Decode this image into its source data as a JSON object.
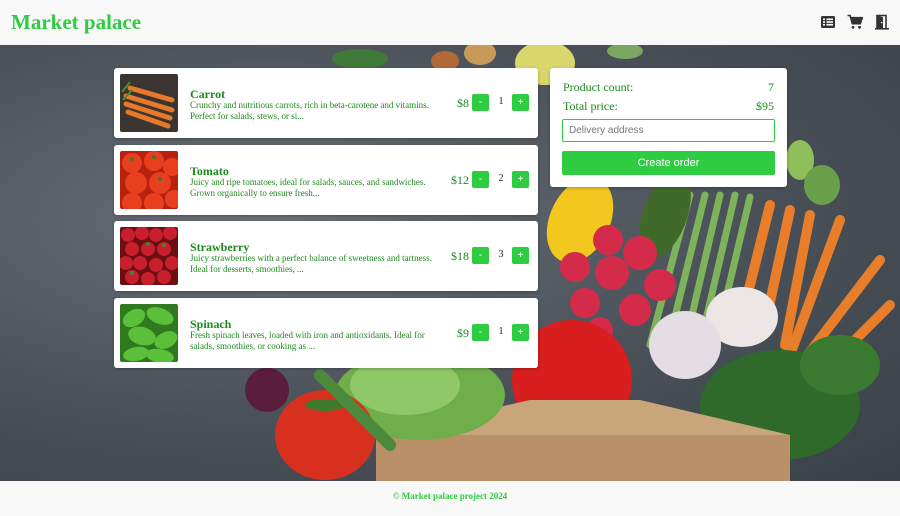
{
  "app": {
    "brand": "Market palace"
  },
  "header": {
    "icons": [
      "list-icon",
      "cart-icon",
      "logout-door-icon"
    ]
  },
  "products": [
    {
      "name": "Carrot",
      "description": "Crunchy and nutritious carrots, rich in beta-carotene and vitamins. Perfect for salads, stews, or si...",
      "price": "$8",
      "quantity": "1",
      "minus_label": "-",
      "plus_label": "+",
      "image": "carrot-image"
    },
    {
      "name": "Tomato",
      "description": "Juicy and ripe tomatoes, ideal for salads, sauces, and sandwiches. Grown organically to ensure fresh...",
      "price": "$12",
      "quantity": "2",
      "minus_label": "-",
      "plus_label": "+",
      "image": "tomato-image"
    },
    {
      "name": "Strawberry",
      "description": "Juicy strawberries with a perfect balance of sweetness and tartness. Ideal for desserts, smoothies, ...",
      "price": "$18",
      "quantity": "3",
      "minus_label": "-",
      "plus_label": "+",
      "image": "strawberry-image"
    },
    {
      "name": "Spinach",
      "description": "Fresh spinach leaves, loaded with iron and antioxidants. Ideal for salads, smoothies, or cooking as ...",
      "price": "$9",
      "quantity": "1",
      "minus_label": "-",
      "plus_label": "+",
      "image": "spinach-image"
    }
  ],
  "order": {
    "count_label": "Product count:",
    "count_value": "7",
    "total_label": "Total price:",
    "total_value": "$95",
    "address_placeholder": "Delivery address",
    "address_value": "",
    "create_label": "Create order"
  },
  "footer": {
    "text": "© Market palace project 2024"
  },
  "colors": {
    "accent": "#2ecc40",
    "text_green": "#1c8a1c",
    "background": "#f8f8f8"
  }
}
